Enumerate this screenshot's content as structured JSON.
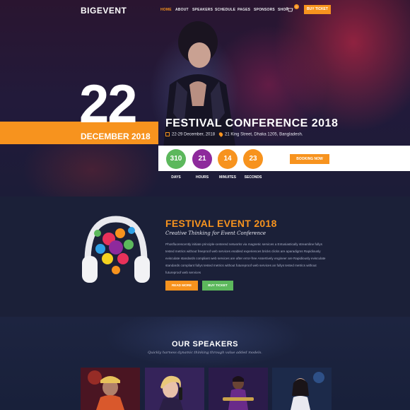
{
  "header": {
    "logo": "BIGEVENT",
    "nav": [
      "HOME",
      "ABOUT",
      "SPEAKERS",
      "SCHEDULE",
      "PAGES",
      "SPONSORS",
      "SHOP"
    ],
    "cart_count": "0",
    "buy_ticket": "BUY TICKET"
  },
  "hero": {
    "day": "22",
    "month_year": "DECEMBER 2018",
    "title": "FESTIVAL CONFERENCE 2018",
    "date_range": "22-29 December, 2018",
    "location": "21 King Street, Dhaka 1205, Bangladesh.",
    "countdown": [
      {
        "value": "310",
        "label": "DAYS",
        "color": "#5cb85c"
      },
      {
        "value": "21",
        "label": "HOURS",
        "color": "#8e2a9c"
      },
      {
        "value": "14",
        "label": "MINUITES",
        "color": "#f7931e"
      },
      {
        "value": "23",
        "label": "SECONDS",
        "color": "#f7931e"
      }
    ],
    "book_now": "BOOKING NOW"
  },
  "about": {
    "title": "FESTIVAL EVENT 2018",
    "subtitle": "Creative Thinking for Event Conference",
    "body": "Phosfluorescently initiate principle-centered networks via magnetic services a Entusiastically streamline fullys tested metrics without freeproof web services enabled experiences bricks clicks are aparadigms Rapidiously evisculate standards compliant web services are after error-free Assertively engineer are Rapidiously evisculate standards compliant fullys tested metrics without futureproof web services an fullys tested metrics without futureproof web services",
    "read_more": "READ MORE",
    "buy_ticket": "BUY TICKET"
  },
  "speakers": {
    "title": "OUR SPEAKERS",
    "subtitle": "Quickly harness dynamic thinking through value added models."
  },
  "colors": {
    "accent": "#f7931e",
    "green": "#5cb85c",
    "purple": "#8e2a9c",
    "bg": "#1b2038"
  }
}
